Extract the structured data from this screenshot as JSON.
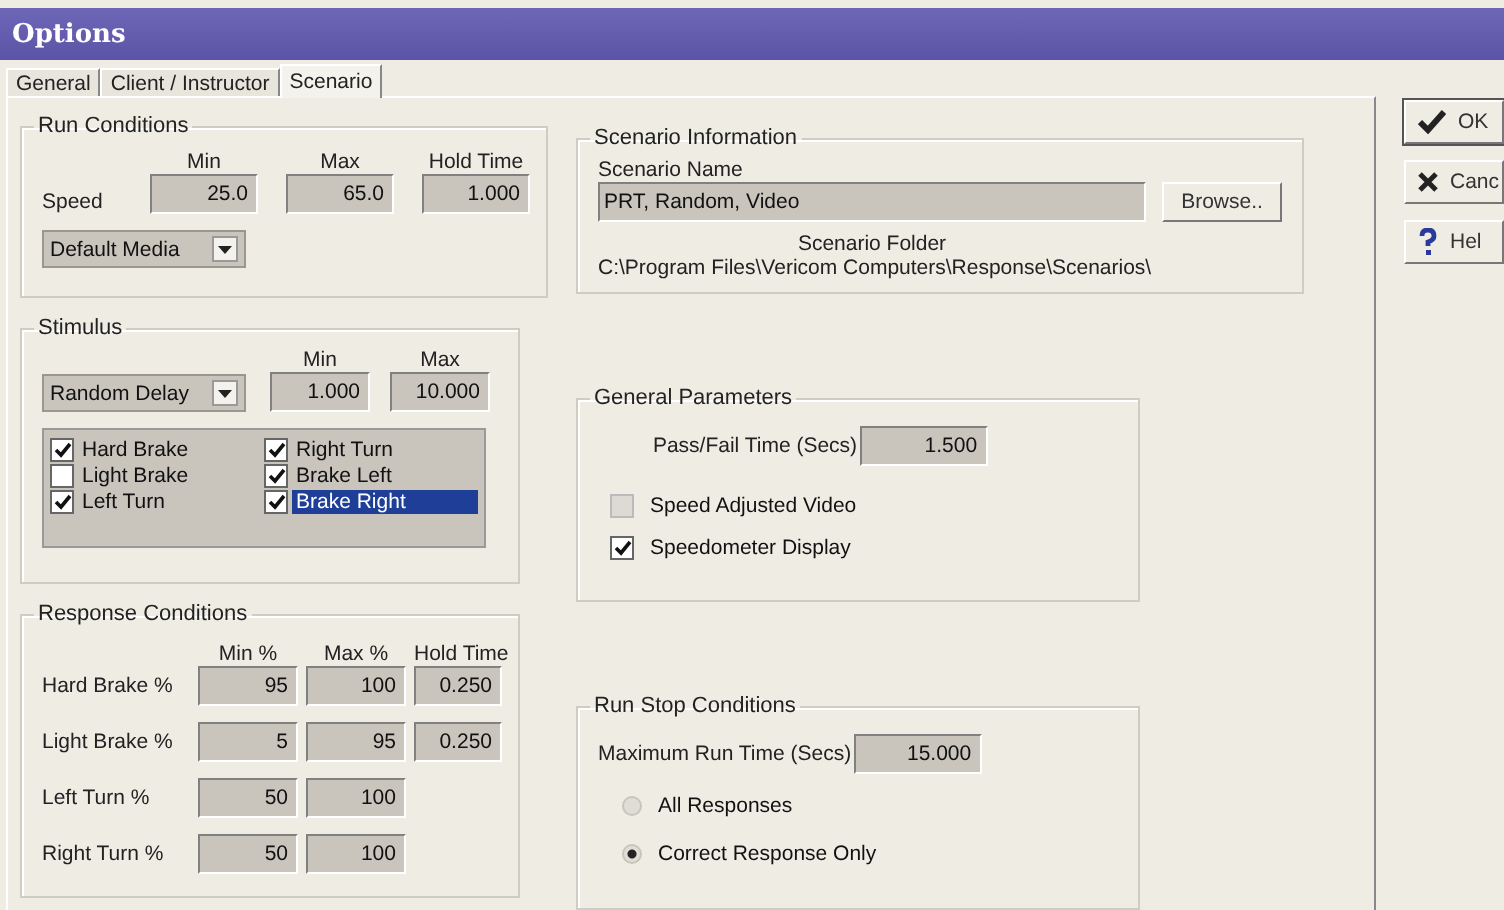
{
  "window": {
    "title": "Options"
  },
  "tabs": [
    {
      "label": "General",
      "selected": false
    },
    {
      "label": "Client / Instructor",
      "selected": false
    },
    {
      "label": "Scenario",
      "selected": true
    }
  ],
  "run_conditions": {
    "title": "Run Conditions",
    "columns": [
      "Min",
      "Max",
      "Hold Time"
    ],
    "speed_label": "Speed",
    "speed_values": [
      "25.0",
      "65.0",
      "1.000"
    ],
    "media": "Default Media"
  },
  "stimulus": {
    "title": "Stimulus",
    "delay": "Random Delay",
    "columns": [
      "Min",
      "Max"
    ],
    "values": [
      "1.000",
      "10.000"
    ],
    "items": [
      {
        "label": "Hard Brake",
        "checked": true,
        "selected": false
      },
      {
        "label": "Right Turn",
        "checked": true,
        "selected": false
      },
      {
        "label": "Light Brake",
        "checked": false,
        "selected": false
      },
      {
        "label": "Brake Left",
        "checked": true,
        "selected": false
      },
      {
        "label": "Left Turn",
        "checked": true,
        "selected": false
      },
      {
        "label": "Brake Right",
        "checked": true,
        "selected": true
      }
    ]
  },
  "response_conditions": {
    "title": "Response Conditions",
    "columns": [
      "Min %",
      "Max %",
      "Hold Time"
    ],
    "rows": [
      {
        "label": "Hard Brake %",
        "values": [
          "95",
          "100",
          "0.250"
        ]
      },
      {
        "label": "Light Brake %",
        "values": [
          "5",
          "95",
          "0.250"
        ]
      },
      {
        "label": "Left Turn %",
        "values": [
          "50",
          "100"
        ]
      },
      {
        "label": "Right Turn %",
        "values": [
          "50",
          "100"
        ]
      }
    ]
  },
  "scenario_information": {
    "title": "Scenario Information",
    "name_label": "Scenario Name",
    "name": "PRT, Random, Video",
    "browse": "Browse..",
    "folder_label": "Scenario Folder",
    "folder": "C:\\Program Files\\Vericom Computers\\Response\\Scenarios\\"
  },
  "general_parameters": {
    "title": "General Parameters",
    "pass_fail_label": "Pass/Fail Time (Secs)",
    "pass_fail": "1.500",
    "options": [
      {
        "label": "Speed Adjusted Video",
        "checked": false,
        "disabled": true
      },
      {
        "label": "Speedometer Display",
        "checked": true,
        "disabled": false
      }
    ]
  },
  "run_stop_conditions": {
    "title": "Run Stop Conditions",
    "max_label": "Maximum Run Time (Secs)",
    "max": "15.000",
    "options": [
      {
        "label": "All Responses",
        "selected": false
      },
      {
        "label": "Correct Response Only",
        "selected": true
      }
    ]
  },
  "buttons": [
    {
      "label": "OK",
      "kind": "ok"
    },
    {
      "label": "Canc",
      "kind": "cancel"
    },
    {
      "label": "Hel",
      "kind": "help"
    }
  ]
}
